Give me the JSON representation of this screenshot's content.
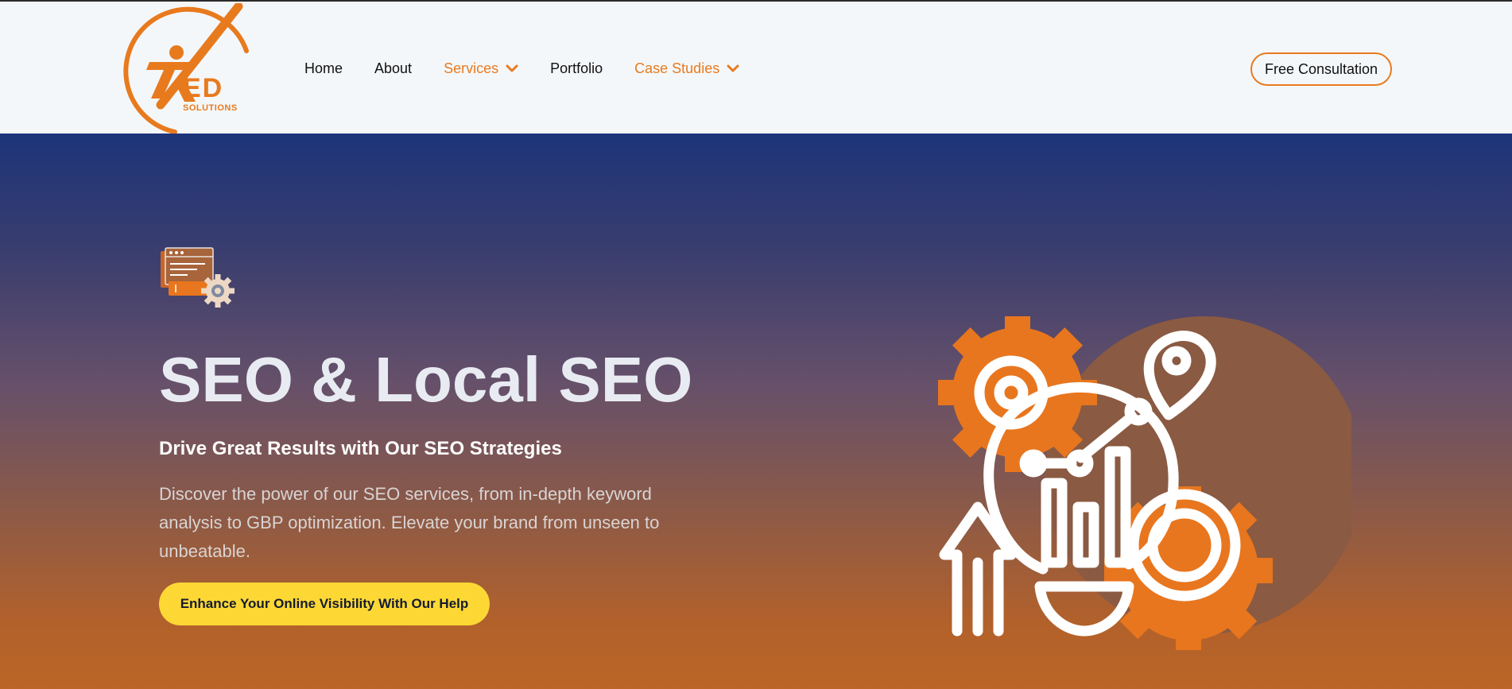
{
  "brand": {
    "logo_main": "ED",
    "logo_sub": "SOLUTIONS"
  },
  "nav": {
    "items": [
      {
        "label": "Home"
      },
      {
        "label": "About"
      },
      {
        "label": "Services"
      },
      {
        "label": "Portfolio"
      },
      {
        "label": "Case Studies"
      }
    ],
    "cta_label": "Free Consultation"
  },
  "hero": {
    "title": "SEO & Local SEO",
    "subtitle": "Drive Great Results with Our SEO Strategies",
    "description": "Discover the power of our SEO services, from in-depth keyword analysis to GBP optimization. Elevate your brand from unseen to unbeatable.",
    "cta_label": "Enhance Your Online Visibility With Our Help"
  },
  "colors": {
    "accent": "#e87a1e",
    "cta_yellow": "#fdd835",
    "hero_top": "#1d3479",
    "hero_bottom": "#bb6527"
  },
  "icons": [
    "logo-mark-icon",
    "chevron-down-icon",
    "browser-gear-icon",
    "seo-analytics-icon"
  ]
}
